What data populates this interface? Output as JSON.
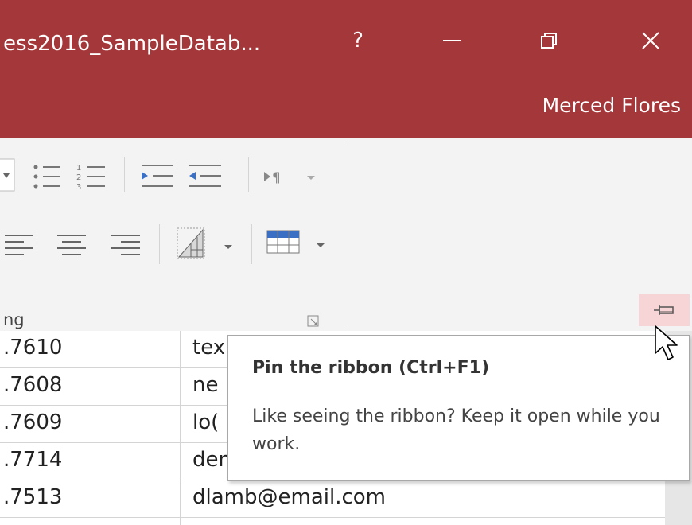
{
  "window": {
    "title": "ess2016_SampleDatab...",
    "help_label": "?",
    "user_name": "Merced Flores"
  },
  "ribbon": {
    "group_label": "ng"
  },
  "table": {
    "rows": [
      {
        "col_a": ".7610",
        "col_b": "tex"
      },
      {
        "col_a": ".7608",
        "col_b": "ne"
      },
      {
        "col_a": ".7609",
        "col_b": "lo("
      },
      {
        "col_a": ".7714",
        "col_b": "denqui@email.com"
      },
      {
        "col_a": ".7513",
        "col_b": "dlamb@email.com"
      }
    ]
  },
  "tooltip": {
    "title": "Pin the ribbon (Ctrl+F1)",
    "body": "Like seeing the ribbon? Keep it open while you work."
  }
}
